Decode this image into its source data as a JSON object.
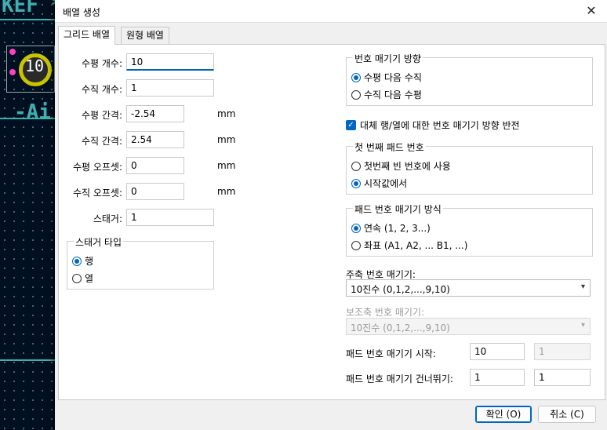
{
  "background": {
    "frag_top": "KEF *",
    "frag_pad": "10",
    "frag_side": "-Ai"
  },
  "dialog": {
    "title": "배열 생성",
    "close_glyph": "✕"
  },
  "tabs": [
    {
      "label": "그리드 배열"
    },
    {
      "label": "원형 배열"
    }
  ],
  "grid": {
    "h_count_label": "수평 개수:",
    "h_count_value": "10",
    "v_count_label": "수직 개수:",
    "v_count_value": "1",
    "h_spacing_label": "수평 간격:",
    "h_spacing_value": "-2.54",
    "v_spacing_label": "수직 간격:",
    "v_spacing_value": "2.54",
    "h_offset_label": "수평 오프셋:",
    "h_offset_value": "0",
    "v_offset_label": "수직 오프셋:",
    "v_offset_value": "0",
    "stagger_label": "스태거:",
    "stagger_value": "1",
    "unit": "mm"
  },
  "stagger_type": {
    "title": "스태거 타입",
    "options": [
      "행",
      "열"
    ]
  },
  "numbering_direction": {
    "title": "번호 매기기 방향",
    "options": [
      "수평 다음 수직",
      "수직 다음 수평"
    ]
  },
  "alternate_reverse": {
    "label": "대체 행/열에 대한 번호 매기기 방향 반전"
  },
  "first_pad": {
    "title": "첫 번째 패드 번호",
    "options": [
      "첫번째 빈 번호에 사용",
      "시작값에서"
    ]
  },
  "pad_numbering": {
    "title": "패드 번호 매기기 방식",
    "options": [
      "연속 (1, 2, 3...)",
      "좌표 (A1, A2, ... B1, ...)"
    ]
  },
  "primary_axis": {
    "label": "주축 번호 매기기:",
    "value": "10진수 (0,1,2,...,9,10)"
  },
  "secondary_axis": {
    "label": "보조축 번호 매기기:",
    "value": "10진수 (0,1,2,...,9,10)"
  },
  "pad_start": {
    "label": "패드 번호 매기기 시작:",
    "value1": "10",
    "value2": "1"
  },
  "pad_skip": {
    "label": "패드 번호 매기기 건너뛰기:",
    "value1": "1",
    "value2": "1"
  },
  "buttons": {
    "ok": "확인 (O)",
    "cancel": "취소 (C)"
  }
}
